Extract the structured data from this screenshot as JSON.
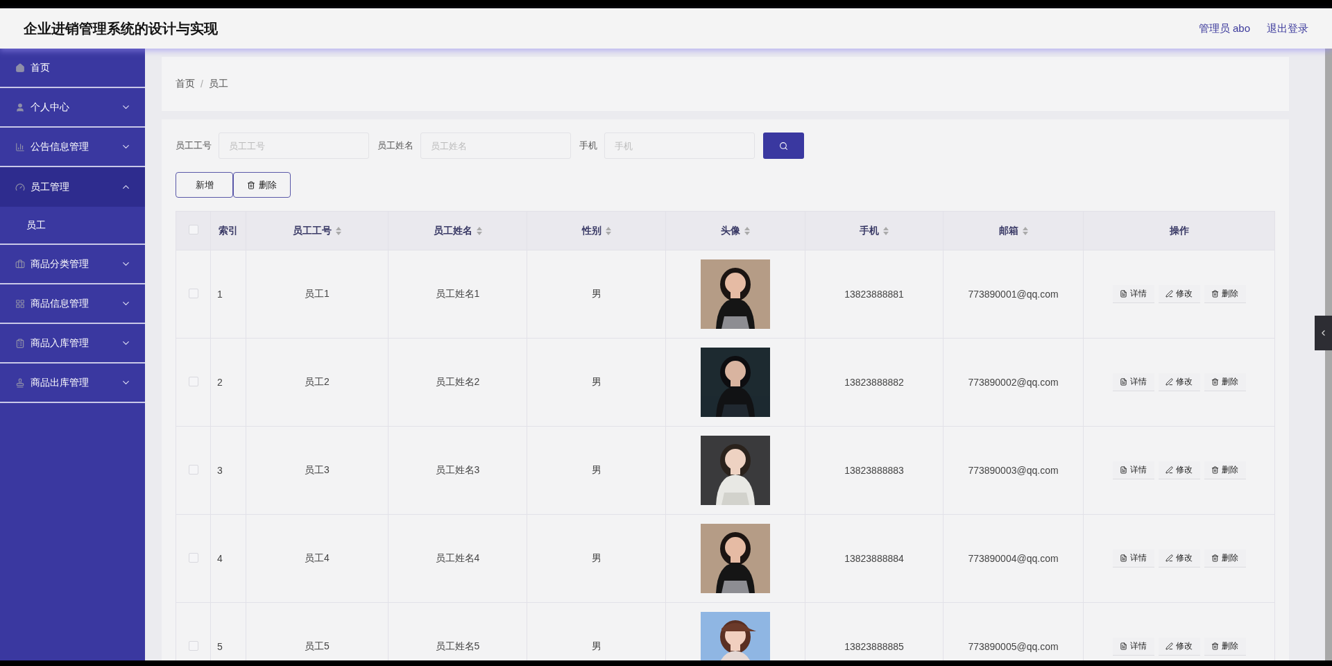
{
  "header": {
    "title": "企业进销管理系统的设计与实现",
    "user": "管理员 abo",
    "logout": "退出登录"
  },
  "sidebar": {
    "items": [
      {
        "label": "首页",
        "kind": "link",
        "selected": false
      },
      {
        "label": "个人中心",
        "kind": "menu",
        "expanded": false,
        "selected": false
      },
      {
        "label": "公告信息管理",
        "kind": "menu",
        "expanded": false,
        "selected": false
      },
      {
        "label": "员工管理",
        "kind": "menu",
        "expanded": true,
        "selected": true,
        "children": [
          {
            "label": "员工"
          }
        ]
      },
      {
        "label": "商品分类管理",
        "kind": "menu",
        "expanded": false,
        "selected": false
      },
      {
        "label": "商品信息管理",
        "kind": "menu",
        "expanded": false,
        "selected": false
      },
      {
        "label": "商品入库管理",
        "kind": "menu",
        "expanded": false,
        "selected": false
      },
      {
        "label": "商品出库管理",
        "kind": "menu",
        "expanded": false,
        "selected": false
      }
    ]
  },
  "breadcrumb": {
    "items": [
      "首页",
      "员工"
    ],
    "separator": "/"
  },
  "filters": [
    {
      "label": "员工工号",
      "placeholder": "员工工号"
    },
    {
      "label": "员工姓名",
      "placeholder": "员工姓名"
    },
    {
      "label": "手机",
      "placeholder": "手机"
    }
  ],
  "toolbar": {
    "add": "新增",
    "delete": "删除"
  },
  "table": {
    "columns": [
      {
        "label": "索引",
        "sortable": false
      },
      {
        "label": "员工工号",
        "sortable": true
      },
      {
        "label": "员工姓名",
        "sortable": true
      },
      {
        "label": "性别",
        "sortable": true
      },
      {
        "label": "头像",
        "sortable": true
      },
      {
        "label": "手机",
        "sortable": true
      },
      {
        "label": "邮箱",
        "sortable": true
      },
      {
        "label": "操作",
        "sortable": false
      }
    ],
    "all_checked": false,
    "rows": [
      {
        "checked": false,
        "index": "1",
        "id": "员工1",
        "name": "员工姓名1",
        "gender": "男",
        "phone": "13823888881",
        "email": "773890001@qq.com",
        "actions": [
          "详情",
          "修改",
          "删除"
        ]
      },
      {
        "checked": false,
        "index": "2",
        "id": "员工2",
        "name": "员工姓名2",
        "gender": "男",
        "phone": "13823888882",
        "email": "773890002@qq.com",
        "actions": [
          "详情",
          "修改",
          "删除"
        ]
      },
      {
        "checked": false,
        "index": "3",
        "id": "员工3",
        "name": "员工姓名3",
        "gender": "男",
        "phone": "13823888883",
        "email": "773890003@qq.com",
        "actions": [
          "详情",
          "修改",
          "删除"
        ]
      },
      {
        "checked": false,
        "index": "4",
        "id": "员工4",
        "name": "员工姓名4",
        "gender": "男",
        "phone": "13823888884",
        "email": "773890004@qq.com",
        "actions": [
          "详情",
          "修改",
          "删除"
        ]
      },
      {
        "checked": false,
        "index": "5",
        "id": "员工5",
        "name": "员工姓名5",
        "gender": "男",
        "phone": "13823888885",
        "email": "773890005@qq.com",
        "actions": [
          "详情",
          "修改",
          "删除"
        ]
      }
    ]
  }
}
